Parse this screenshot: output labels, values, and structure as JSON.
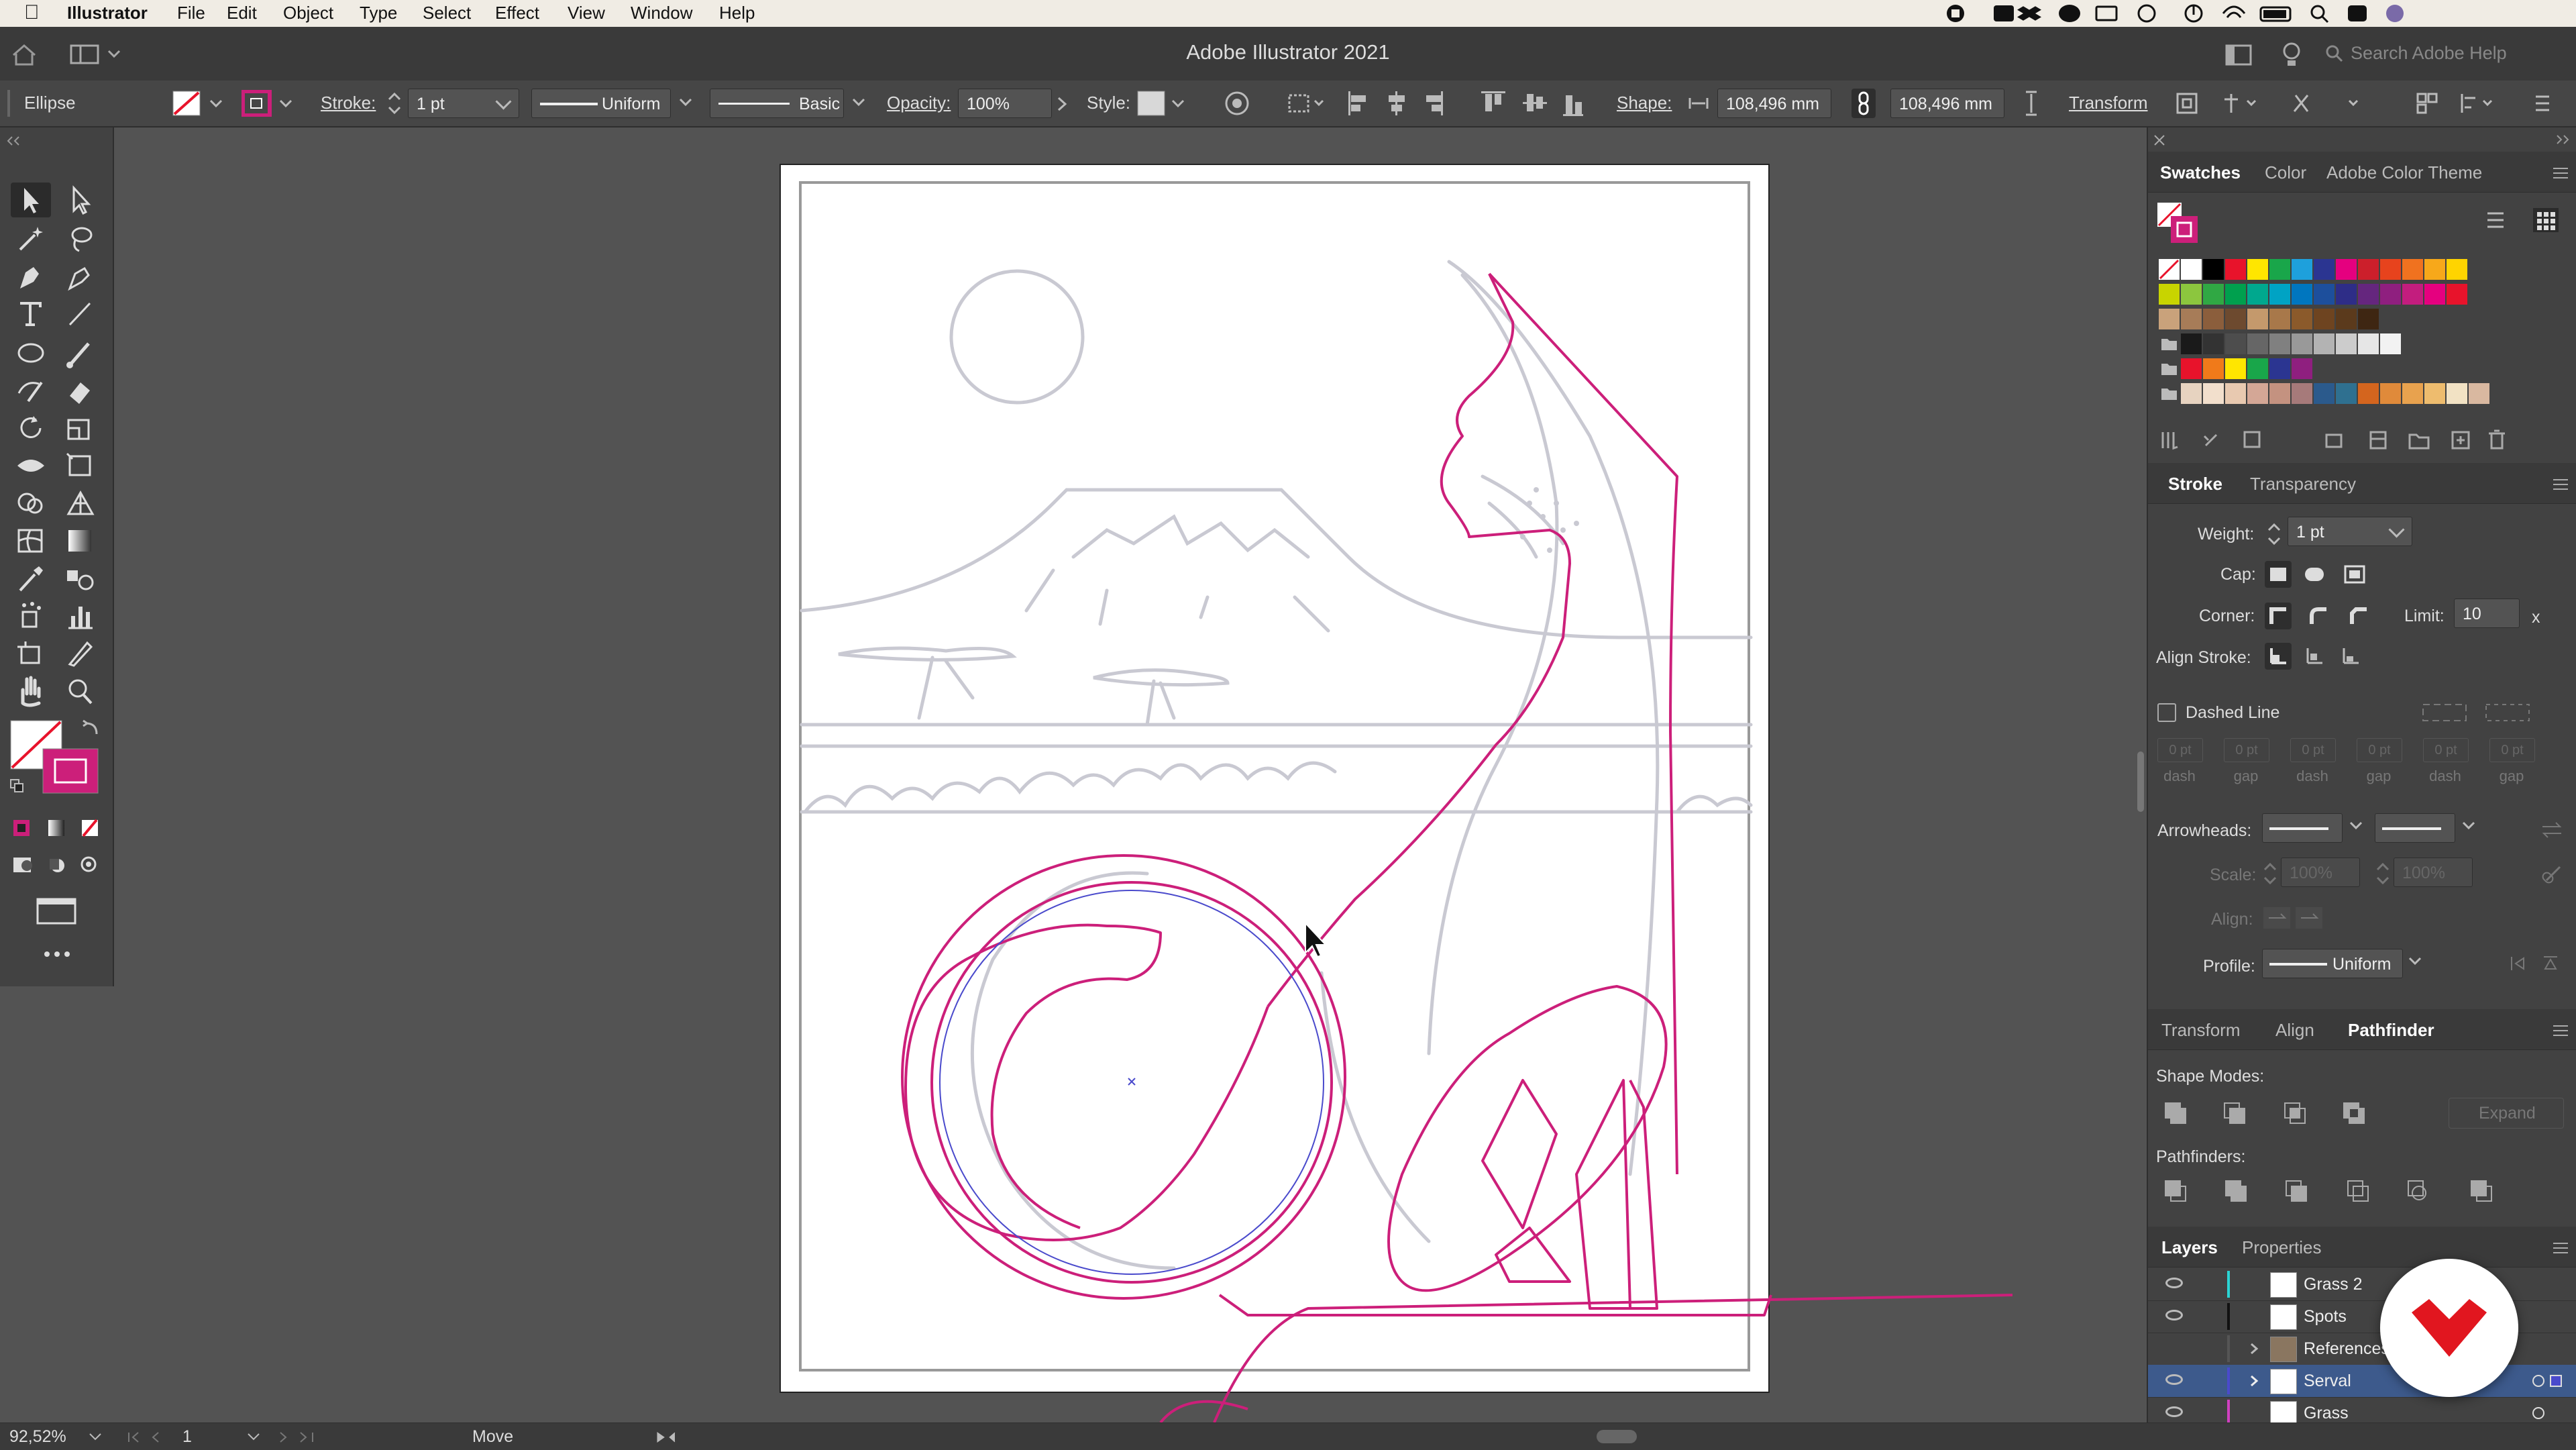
{
  "menubar": {
    "app_name": "Illustrator",
    "items": [
      "File",
      "Edit",
      "Object",
      "Type",
      "Select",
      "Effect",
      "View",
      "Window",
      "Help"
    ]
  },
  "window_title": "Adobe Illustrator 2021",
  "search": {
    "placeholder": "Search Adobe Help"
  },
  "control_bar": {
    "selection_type": "Ellipse",
    "stroke_label": "Stroke:",
    "stroke_weight": "1 pt",
    "profile": "Uniform",
    "brush": "Basic",
    "opacity_label": "Opacity:",
    "opacity_value": "100%",
    "style_label": "Style:",
    "shape_label": "Shape:",
    "shape_width": "108,496 mm",
    "shape_height": "108,496 mm",
    "transform_label": "Transform"
  },
  "swatches_panel": {
    "tabs": [
      "Swatches",
      "Color",
      "Adobe Color Theme"
    ],
    "active_tab": "Swatches"
  },
  "stroke_panel": {
    "tabs": [
      "Stroke",
      "Transparency"
    ],
    "active_tab": "Stroke",
    "weight_label": "Weight:",
    "weight_value": "1 pt",
    "cap_label": "Cap:",
    "corner_label": "Corner:",
    "limit_label": "Limit:",
    "limit_value": "10",
    "limit_unit": "x",
    "align_label": "Align Stroke:",
    "dashed_label": "Dashed Line",
    "dash_fields": [
      {
        "value": "0 pt",
        "label": "dash"
      },
      {
        "value": "0 pt",
        "label": "gap"
      },
      {
        "value": "0 pt",
        "label": "dash"
      },
      {
        "value": "0 pt",
        "label": "gap"
      },
      {
        "value": "0 pt",
        "label": "dash"
      },
      {
        "value": "0 pt",
        "label": "gap"
      }
    ],
    "arrowheads_label": "Arrowheads:",
    "scale_label": "Scale:",
    "scale_value_1": "100%",
    "scale_value_2": "100%",
    "align_arrow_label": "Align:",
    "profile_label": "Profile:",
    "profile_value": "Uniform"
  },
  "pathfinder_panel": {
    "tabs": [
      "Transform",
      "Align",
      "Pathfinder"
    ],
    "active_tab": "Pathfinder",
    "shape_modes_label": "Shape Modes:",
    "expand_label": "Expand",
    "pathfinders_label": "Pathfinders:"
  },
  "layers_panel": {
    "tabs": [
      "Layers",
      "Properties"
    ],
    "active_tab": "Layers",
    "layers": [
      {
        "name": "Grass 2",
        "color": "#2ad4d4"
      },
      {
        "name": "Spots",
        "color": "#111111"
      },
      {
        "name": "References",
        "color": "#555555"
      },
      {
        "name": "Serval",
        "color": "#4a4acc"
      },
      {
        "name": "Grass",
        "color": "#d040c0"
      }
    ]
  },
  "status_bar": {
    "zoom": "92,52%",
    "artboard": "1",
    "tool_status": "Move"
  },
  "colors": {
    "accent_stroke": "#cc1f7a",
    "selected_layer_bg": "#3d5a8c",
    "swatch_grid": [
      [
        "none",
        "#ffffff",
        "#000000",
        "#e8132b",
        "#ffe600",
        "#19a64a",
        "#1ea0dc",
        "#2b3591",
        "#e5007f",
        "#cc1f2b",
        "#e7431d",
        "#f0721f",
        "#f7a81a",
        "#ffd400"
      ],
      [
        "#c8d400",
        "#8cc63e",
        "#30a844",
        "#00a04e",
        "#00a88e",
        "#00a3c4",
        "#0076bf",
        "#1d4f9c",
        "#2e2d87",
        "#65267e",
        "#8f1f7f",
        "#c31d7e",
        "#e5007f",
        "#e8132b"
      ],
      [
        "#c9a27b",
        "#a77c58",
        "#8b5e3c",
        "#6d4a2f",
        "#c4996c",
        "#a8784a",
        "#8b5a2b",
        "#6e4420",
        "#5b3a1c",
        "#3e2612"
      ],
      [
        "folder",
        "#1a1a1a",
        "#333333",
        "#4d4d4d",
        "#666666",
        "#808080",
        "#999999",
        "#b3b3b3",
        "#cccccc",
        "#e6e6e6",
        "#f2f2f2"
      ],
      [
        "folder",
        "#e8132b",
        "#f07a1a",
        "#ffe600",
        "#19a64a",
        "#2b3591",
        "#8f1f7f"
      ],
      [
        "folder",
        "#e7d3c0",
        "#f2dfcc",
        "#e8c9b0",
        "#d4a796",
        "#c49280",
        "#a67a7a",
        "#2b5a8c",
        "#2f7090",
        "#d4651e",
        "#e08a3a",
        "#e8a24e",
        "#eebc6e",
        "#f2e2c4",
        "#d9b8a0"
      ]
    ]
  }
}
